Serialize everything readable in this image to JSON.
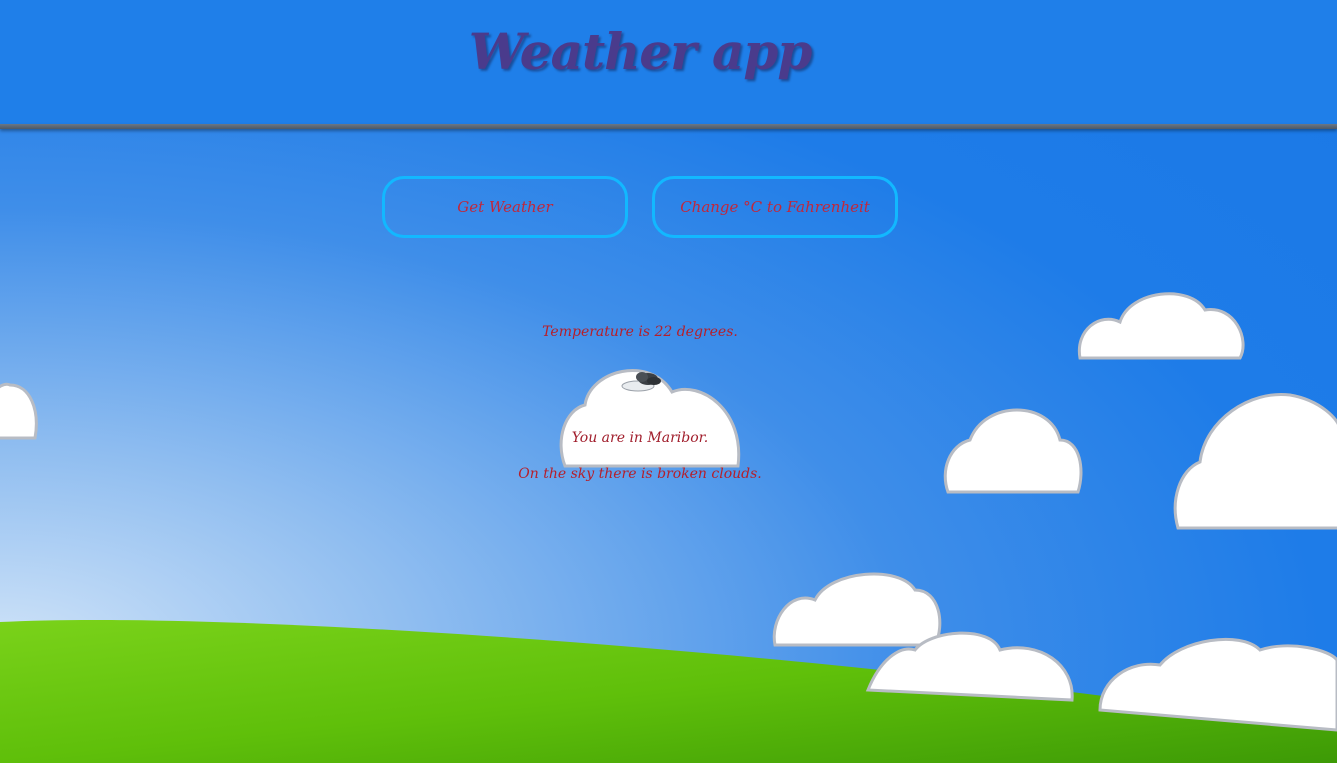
{
  "header": {
    "title": "Weather app"
  },
  "buttons": {
    "get_weather": "Get Weather",
    "change_unit": "Change °C to Fahrenheit"
  },
  "weather": {
    "temperature_text": "Temperature is 22 degrees.",
    "location_text": "You are in Maribor.",
    "sky_text": "On the sky there is broken clouds.",
    "icon": "broken-clouds-icon"
  },
  "colors": {
    "sky": "#1e7ce8",
    "title": "#4a3b8c",
    "button_border": "#12b8ff",
    "text": "#b51f2b",
    "grass": "#5fbf0a"
  }
}
